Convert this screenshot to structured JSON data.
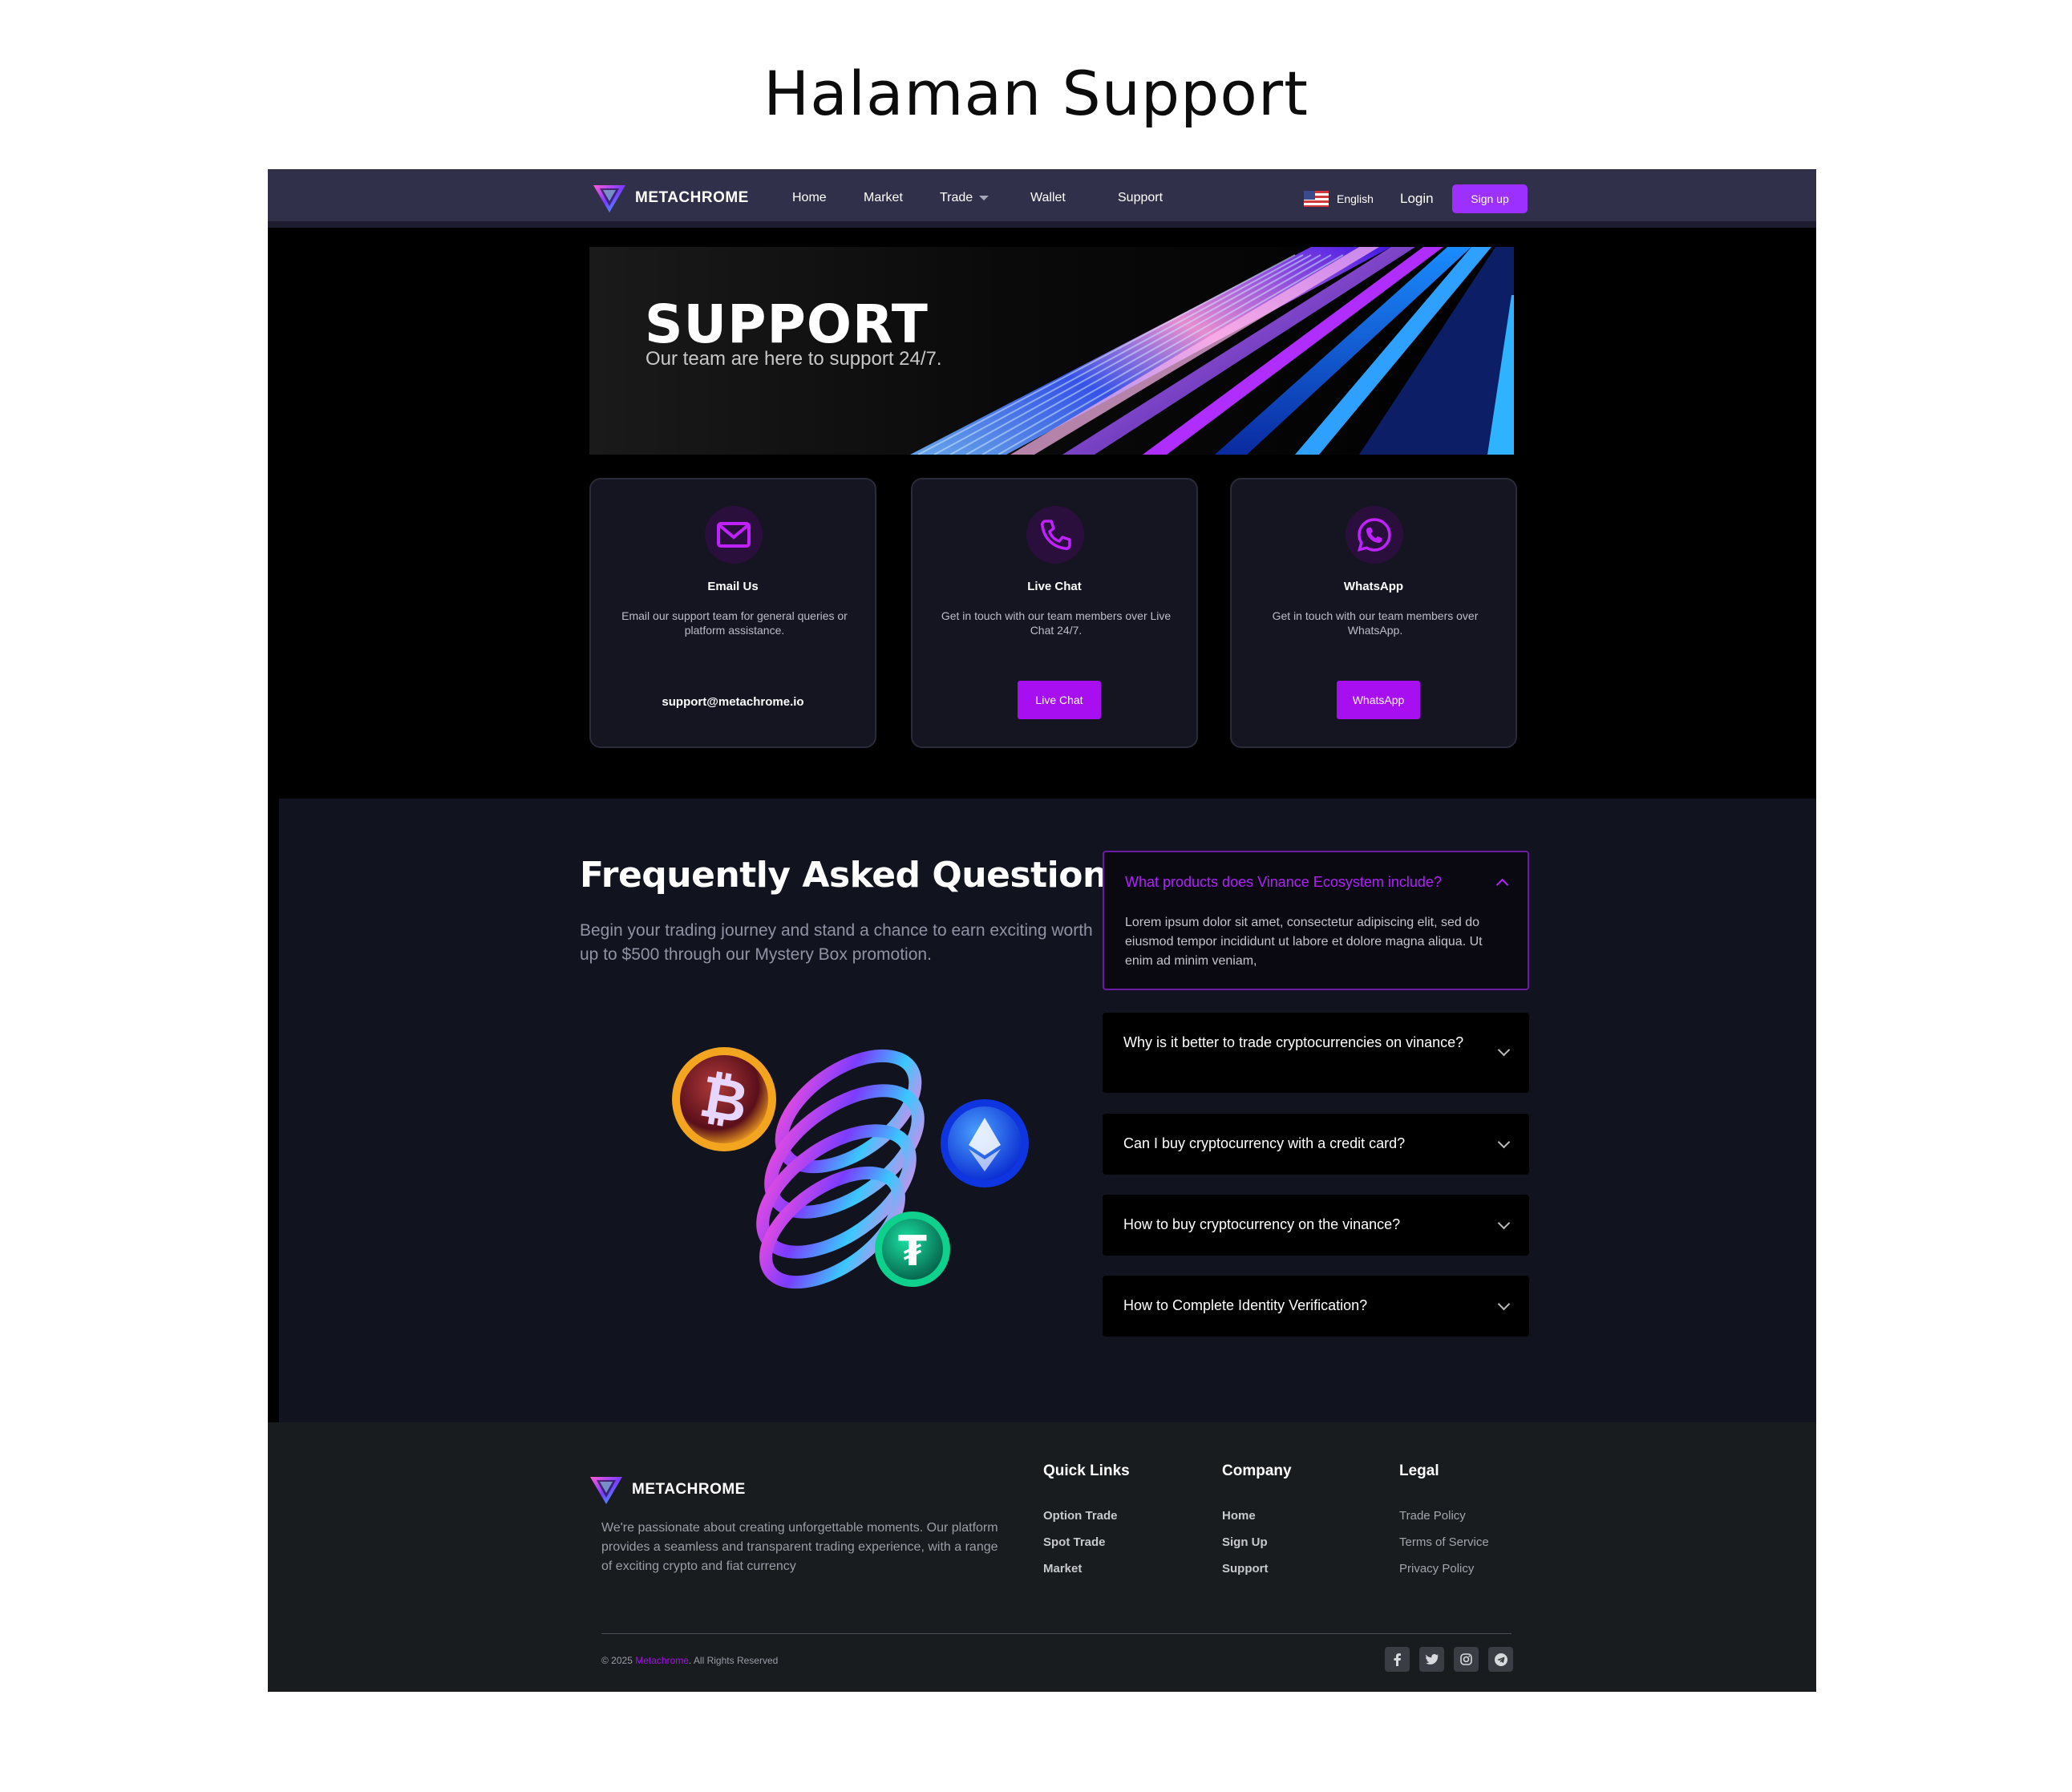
{
  "page_title": "Halaman Support",
  "nav": {
    "brand": "METACHROME",
    "links": [
      "Home",
      "Market",
      "Trade",
      "Wallet",
      "Support"
    ],
    "language": "English",
    "login": "Login",
    "signup": "Sign up"
  },
  "hero": {
    "title": "SUPPORT",
    "subtitle": "Our team are here to support 24/7."
  },
  "cards": [
    {
      "icon": "mail-icon",
      "title": "Email Us",
      "description": "Email our support team for general queries or platform assistance.",
      "action": "support@metachrome.io"
    },
    {
      "icon": "phone-icon",
      "title": "Live Chat",
      "description": "Get in touch with our team members over Live Chat 24/7.",
      "action": "Live Chat"
    },
    {
      "icon": "whatsapp-icon",
      "title": "WhatsApp",
      "description": "Get in touch with our team members over WhatsApp.",
      "action": "WhatsApp"
    }
  ],
  "faq": {
    "heading": "Frequently Asked Questions",
    "description": "Begin your trading journey and stand a chance to earn exciting worth up to $500 through our Mystery Box promotion.",
    "items": [
      {
        "question": "What products does Vinance Ecosystem include?",
        "answer": "Lorem ipsum dolor sit amet, consectetur adipiscing elit, sed do eiusmod tempor incididunt ut labore et dolore magna aliqua. Ut enim ad minim veniam,",
        "open": true
      },
      {
        "question": "Why is it better to trade cryptocurrencies on vinance?",
        "open": false
      },
      {
        "question": "Can I buy cryptocurrency with a credit card?",
        "open": false
      },
      {
        "question": "How to buy cryptocurrency on the vinance?",
        "open": false
      },
      {
        "question": "How to Complete Identity Verification?",
        "open": false
      }
    ]
  },
  "footer": {
    "brand": "METACHROME",
    "description": "We're passionate about creating unforgettable moments. Our platform provides a seamless and transparent trading experience, with a range of exciting crypto and fiat currency",
    "quick_links": {
      "title": "Quick Links",
      "items": [
        "Option Trade",
        "Spot Trade",
        "Market"
      ]
    },
    "company": {
      "title": "Company",
      "items": [
        "Home",
        "Sign Up",
        "Support"
      ]
    },
    "legal": {
      "title": "Legal",
      "items": [
        "Trade Policy",
        "Terms of Service",
        "Privacy Policy"
      ]
    },
    "copyright_prefix": "© 2025 ",
    "copyright_brand": "Metachrome",
    "copyright_suffix": ". All Rights Reserved",
    "socials": [
      "facebook-icon",
      "twitter-icon",
      "instagram-icon",
      "telegram-icon"
    ]
  },
  "colors": {
    "accent": "#a70ef0",
    "signup": "#9b30ff",
    "nav_bg": "#31304a",
    "faq_bg": "#11131f",
    "footer_bg": "#181c1e"
  }
}
